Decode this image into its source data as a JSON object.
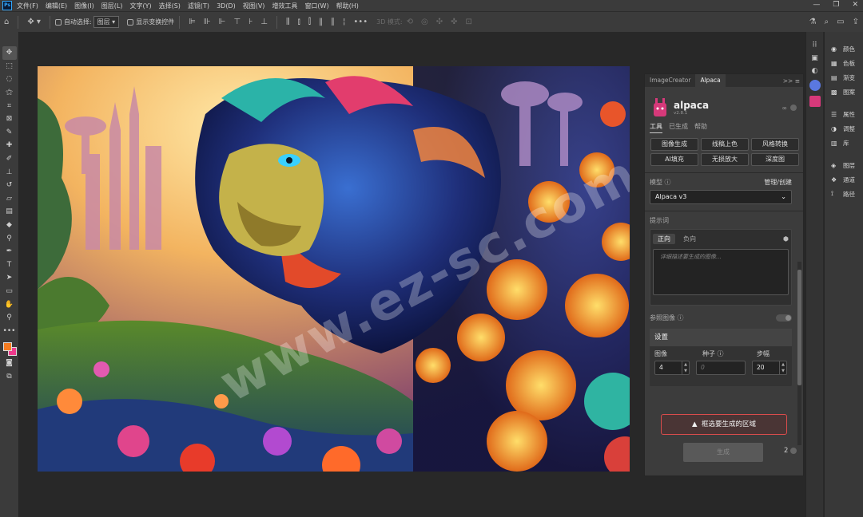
{
  "app": {
    "logo": "Ps",
    "menus": [
      "文件(F)",
      "编辑(E)",
      "图像(I)",
      "图层(L)",
      "文字(Y)",
      "选择(S)",
      "滤镜(T)",
      "3D(D)",
      "视图(V)",
      "增效工具",
      "窗口(W)",
      "帮助(H)"
    ],
    "window_controls": [
      "—",
      "❐",
      "✕"
    ]
  },
  "options": {
    "auto_select_label": "自动选择:",
    "auto_select_value": "图层",
    "show_transform_label": "显示变换控件",
    "mode_3d_label": "3D 模式:"
  },
  "tools": [
    "move-tool",
    "marquee-tool",
    "lasso-tool",
    "magic-wand-tool",
    "crop-tool",
    "frame-tool",
    "eyedropper-tool",
    "healing-tool",
    "brush-tool",
    "stamp-tool",
    "history-brush-tool",
    "eraser-tool",
    "gradient-tool",
    "blur-tool",
    "dodge-tool",
    "pen-tool",
    "type-tool",
    "path-select-tool",
    "rectangle-tool",
    "hand-tool",
    "zoom-tool",
    "more-tools"
  ],
  "colors": {
    "foreground": "#f47b20",
    "background": "#ee3a8c",
    "accent": "#d94c4c"
  },
  "canvas": {
    "watermark": "www.ez-sc.com"
  },
  "plugin": {
    "tabs": [
      "ImageCreator",
      "Alpaca"
    ],
    "active_tab": "Alpaca",
    "tab_controls": ">>  ≡",
    "name": "alpaca",
    "version": "v2.8.1",
    "nav": [
      "工具",
      "已生成",
      "帮助"
    ],
    "functions": [
      "图像生成",
      "线稿上色",
      "风格转换",
      "AI填充",
      "无损放大",
      "深度图"
    ],
    "model_label": "模型 ⓘ",
    "model_manage": "管理/创建",
    "model_value": "Alpaca v3",
    "prompt_label": "提示词",
    "prompt_tabs": [
      "正向",
      "负向"
    ],
    "prompt_placeholder": "详细描述要生成的图像...",
    "ref_image_label": "参照图像 ⓘ",
    "settings_title": "设置",
    "settings_labels": [
      "图像",
      "种子 ⓘ",
      "步幅"
    ],
    "image_count": "4",
    "seed_placeholder": "0",
    "steps": "20",
    "warning_button": "框选要生成的区域",
    "generate_button": "生成",
    "generate_count": "2"
  },
  "right_panels": [
    {
      "icon": "palette-icon",
      "label": "颜色"
    },
    {
      "icon": "swatches-icon",
      "label": "色板"
    },
    {
      "icon": "gradient-icon",
      "label": "渐变"
    },
    {
      "icon": "pattern-icon",
      "label": "图案"
    },
    {
      "icon": "properties-icon",
      "label": "属性"
    },
    {
      "icon": "adjustments-icon",
      "label": "调整"
    },
    {
      "icon": "library-icon",
      "label": "库"
    },
    {
      "icon": "layers-icon",
      "label": "图层"
    },
    {
      "icon": "channels-icon",
      "label": "通道"
    },
    {
      "icon": "paths-icon",
      "label": "路径"
    }
  ]
}
